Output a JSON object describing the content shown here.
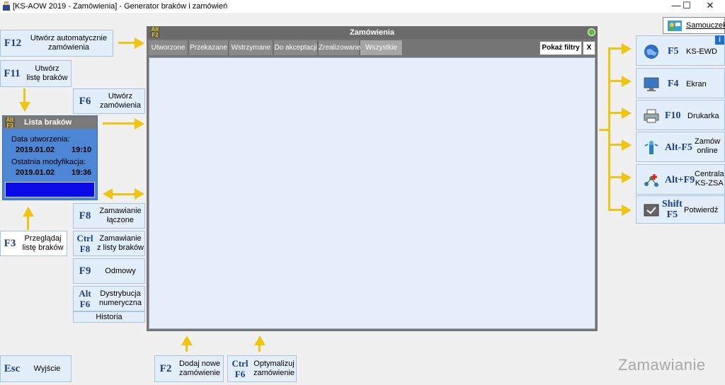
{
  "window": {
    "title": "[KS-AOW 2019 - Zamówienia] - Generator braków i zamówień",
    "minimize": "—",
    "maximize": "☐",
    "close": "✕"
  },
  "tutorial": {
    "label": "Samouczek"
  },
  "left_buttons": {
    "f12": {
      "key": "F12",
      "label_line1": "Utwórz automatycznie",
      "label_line2": "zamówienia"
    },
    "f11": {
      "key": "F11",
      "label_line1": "Utwórz",
      "label_line2": "listę braków"
    },
    "f6": {
      "key": "F6",
      "label_line1": "Utwórz",
      "label_line2": "zamówienia"
    },
    "f3": {
      "key": "F3",
      "label_line1": "Przeglądaj",
      "label_line2": "listę braków"
    },
    "f8": {
      "key": "F8",
      "label_line1": "Zamawianie",
      "label_line2": "łączone"
    },
    "ctrlf8": {
      "key_line1": "Ctrl",
      "key_line2": "F8",
      "label_line1": "Zamawianie",
      "label_line2": "z listy braków"
    },
    "f9": {
      "key": "F9",
      "label": "Odmowy"
    },
    "altf6": {
      "key_line1": "Alt",
      "key_line2": "F6",
      "label_line1": "Dystrybucja",
      "label_line2": "numeryczna"
    },
    "historia": {
      "label": "Historia"
    },
    "esc": {
      "key": "Esc",
      "label": "Wyjście"
    }
  },
  "lista_brakow": {
    "alt_badge_top": "Alt",
    "alt_badge_bottom": "F3",
    "title": "Lista braków",
    "created_label": "Data utworzenia:",
    "created_date": "2019.01.02",
    "created_time": "19:10",
    "modified_label": "Ostatnia modyfikacja:",
    "modified_date": "2019.01.02",
    "modified_time": "19:36"
  },
  "main": {
    "alt_badge_top": "Alt",
    "alt_badge_bottom": "F2",
    "title": "Zamówienia",
    "tabs": [
      "Utworzone",
      "Przekazane",
      "Wstrzymane",
      "Do akceptacji",
      "Zrealizowane",
      "Wszystkie"
    ],
    "active_tab": "Wszystkie",
    "show_filters": "Pokaż filtry",
    "close_filters": "X"
  },
  "bottom_buttons": {
    "f2": {
      "key": "F2",
      "label_line1": "Dodaj nowe",
      "label_line2": "zamówienie"
    },
    "ctrlf6": {
      "key_line1": "Ctrl",
      "key_line2": "F6",
      "label_line1": "Optymalizuj",
      "label_line2": "zamówienie"
    }
  },
  "right_buttons": {
    "f5": {
      "key": "F5",
      "label": "KS-EWD",
      "info": "i"
    },
    "f4": {
      "key": "F4",
      "label": "Ekran"
    },
    "f10": {
      "key": "F10",
      "label": "Drukarka"
    },
    "altf5": {
      "key": "Alt-F5",
      "label_line1": "Zamów",
      "label_line2": "online"
    },
    "altf9": {
      "key": "Alt+F9",
      "label_line1": "Centrala",
      "label_line2": "KS-ZSA"
    },
    "shiftf5": {
      "key_line1": "Shift",
      "key_line2": "F5",
      "label": "Potwierdź"
    }
  },
  "watermark": "Zamawianie",
  "colors": {
    "accent_yellow": "#f1c40f",
    "button_bg": "#e3eefb",
    "key_blue": "#1c3f8c",
    "panel_gray": "#757575"
  }
}
